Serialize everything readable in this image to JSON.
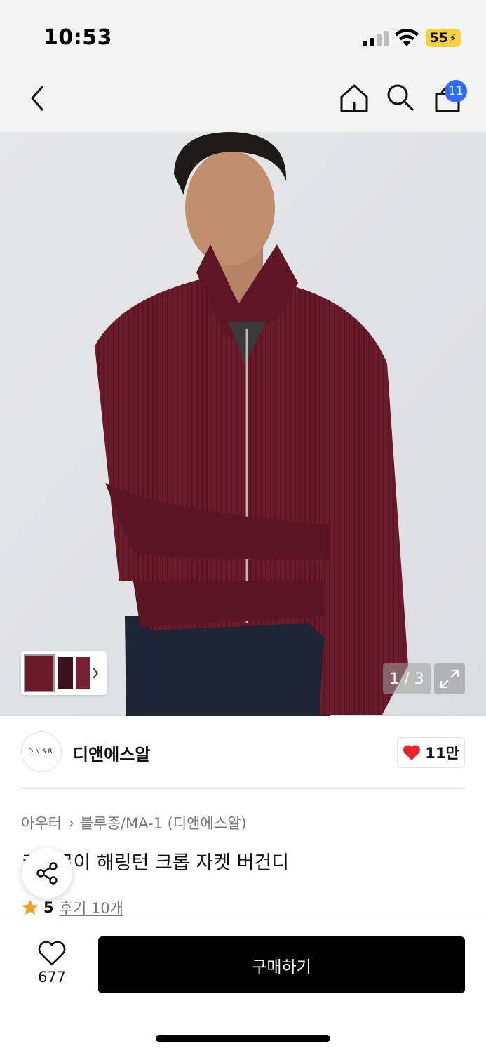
{
  "status_bar": {
    "time": "10:53",
    "battery": "55"
  },
  "nav": {
    "back_icon": "chevron-left-icon",
    "home_icon": "home-icon",
    "search_icon": "search-icon",
    "cart_icon": "shopping-bag-icon",
    "cart_count": "11"
  },
  "gallery": {
    "page_indicator": "1 / 3",
    "expand_icon": "expand-icon"
  },
  "brand": {
    "logo_text": "DNSR",
    "name": "디앤에스알",
    "likes": "11만"
  },
  "breadcrumb": {
    "category": "아우터",
    "subcategory": "블루종/MA-1 (디앤에스알)"
  },
  "product": {
    "title": "코듀로이 해링턴 크롭 자켓 버건디",
    "rating": "5",
    "reviews": "후기 10개"
  },
  "bottom_bar": {
    "wish_count": "677",
    "buy_label": "구매하기"
  },
  "colors": {
    "accent_badge": "#2f6bff",
    "heart": "#e8232b",
    "star": "#f7a01b",
    "jacket": "#6b1a2a",
    "battery": "#f7d13b"
  }
}
